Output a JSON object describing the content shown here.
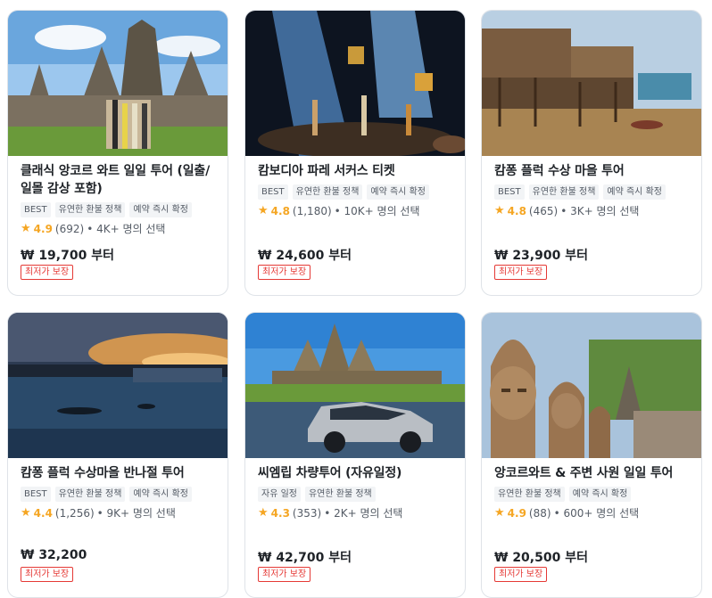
{
  "cards": [
    {
      "title": "클래식 앙코르 와트 일일 투어 (일출/일몰 감상 포함)",
      "tags": [
        "BEST",
        "유연한 환불 정책",
        "예약 즉시 확정"
      ],
      "score": "4.9",
      "reviews": "(692)",
      "chosen": "• 4K+ 명의 선택",
      "price": "₩ 19,700 부터",
      "badge": "최저가 보장"
    },
    {
      "title": "캄보디아 파레 서커스 티켓",
      "tags": [
        "BEST",
        "유연한 환불 정책",
        "예약 즉시 확정"
      ],
      "score": "4.8",
      "reviews": "(1,180)",
      "chosen": "• 10K+ 명의 선택",
      "price": "₩ 24,600 부터",
      "badge": "최저가 보장"
    },
    {
      "title": "캄퐁 플럭 수상 마을 투어",
      "tags": [
        "BEST",
        "유연한 환불 정책",
        "예약 즉시 확정"
      ],
      "score": "4.8",
      "reviews": "(465)",
      "chosen": "• 3K+ 명의 선택",
      "price": "₩ 23,900 부터",
      "badge": "최저가 보장"
    },
    {
      "title": "캄퐁 플럭 수상마을 반나절 투어",
      "tags": [
        "BEST",
        "유연한 환불 정책",
        "예약 즉시 확정"
      ],
      "score": "4.4",
      "reviews": "(1,256)",
      "chosen": "• 9K+ 명의 선택",
      "price": "₩ 32,200",
      "badge": "최저가 보장"
    },
    {
      "title": "씨엠립 차량투어 (자유일정)",
      "tags": [
        "자유 일정",
        "유연한 환불 정책"
      ],
      "score": "4.3",
      "reviews": "(353)",
      "chosen": "• 2K+ 명의 선택",
      "price": "₩ 42,700 부터",
      "badge": "최저가 보장"
    },
    {
      "title": "앙코르와트 & 주변 사원 일일 투어",
      "tags": [
        "유연한 환불 정책",
        "예약 즉시 확정"
      ],
      "score": "4.9",
      "reviews": "(88)",
      "chosen": "• 600+ 명의 선택",
      "price": "₩ 20,500 부터",
      "badge": "최저가 보장"
    }
  ],
  "colors": {
    "star": "#f5a623",
    "badge": "#e53935"
  },
  "icons": {
    "rating": "star-icon"
  }
}
